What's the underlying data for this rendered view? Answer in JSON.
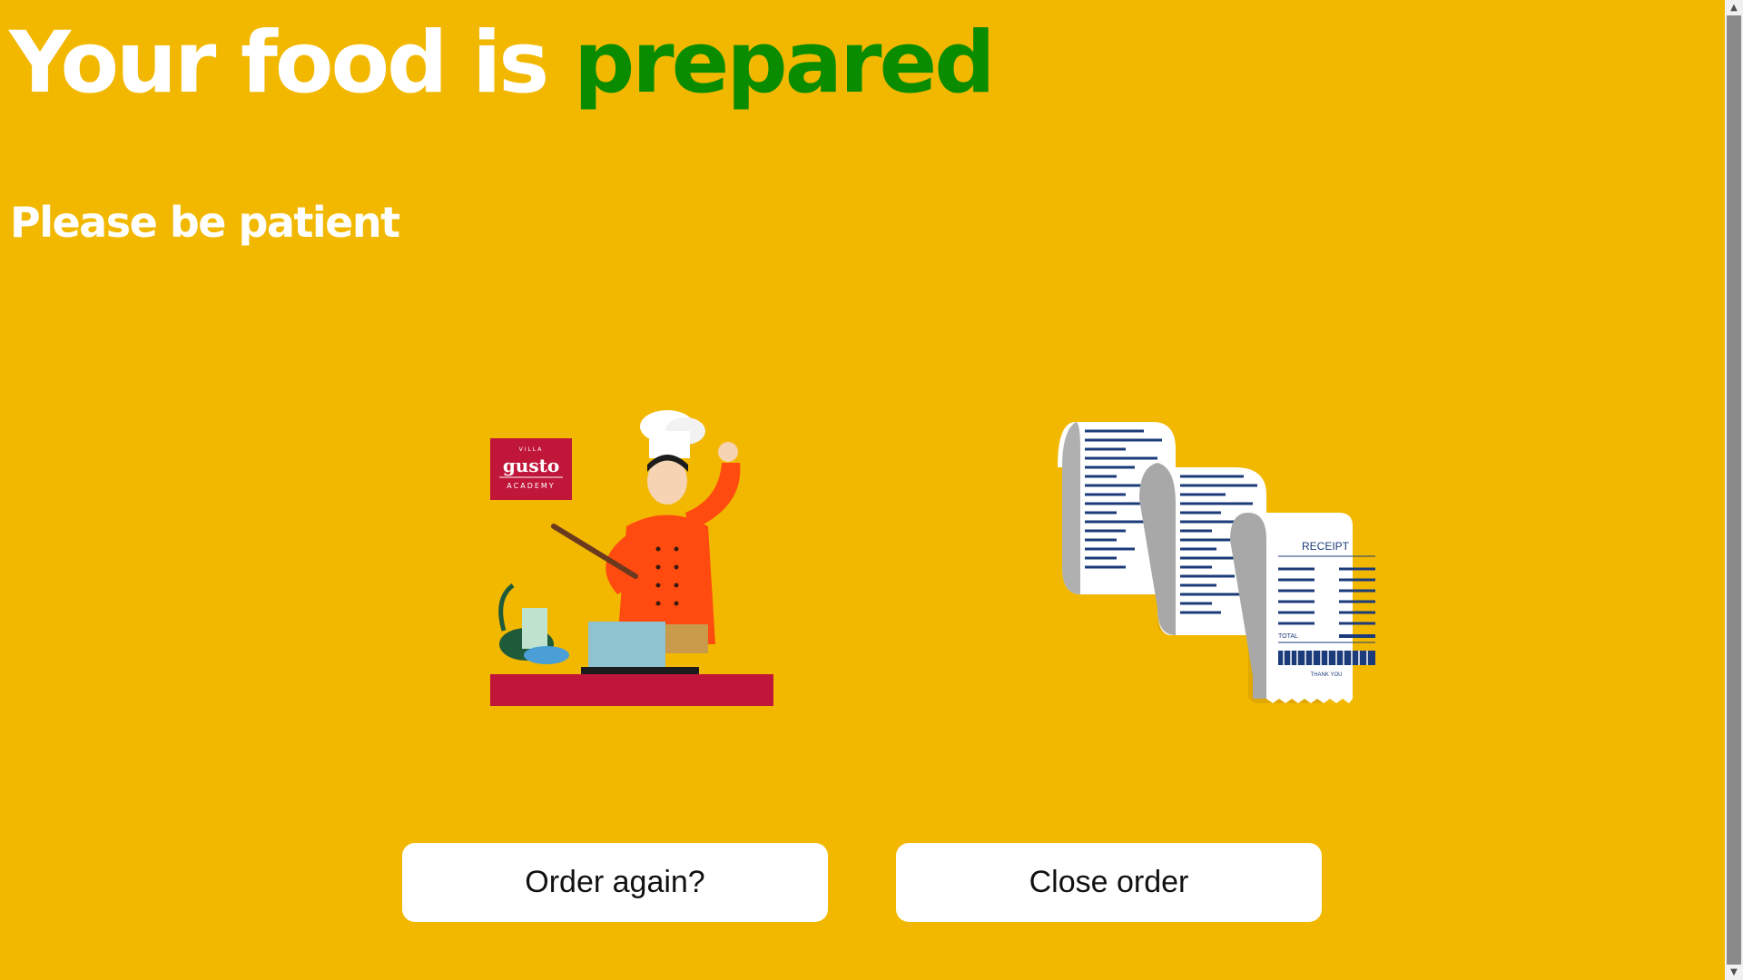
{
  "header": {
    "title_prefix": "Your food is ",
    "title_highlight": "prepared",
    "subtitle": "Please be patient"
  },
  "illustrations": {
    "chef": {
      "logo_line1": "VILLA",
      "logo_line2": "gusto",
      "logo_line3": "ACADEMY"
    },
    "receipt": {
      "heading": "RECEIPT",
      "total_label": "TOTAL",
      "footer": "THANK YOU"
    }
  },
  "actions": {
    "order_again_label": "Order again?",
    "close_order_label": "Close order"
  },
  "colors": {
    "background": "#f2b800",
    "title_text": "#ffffff",
    "title_accent": "#0a8c00",
    "button_bg": "#ffffff"
  }
}
